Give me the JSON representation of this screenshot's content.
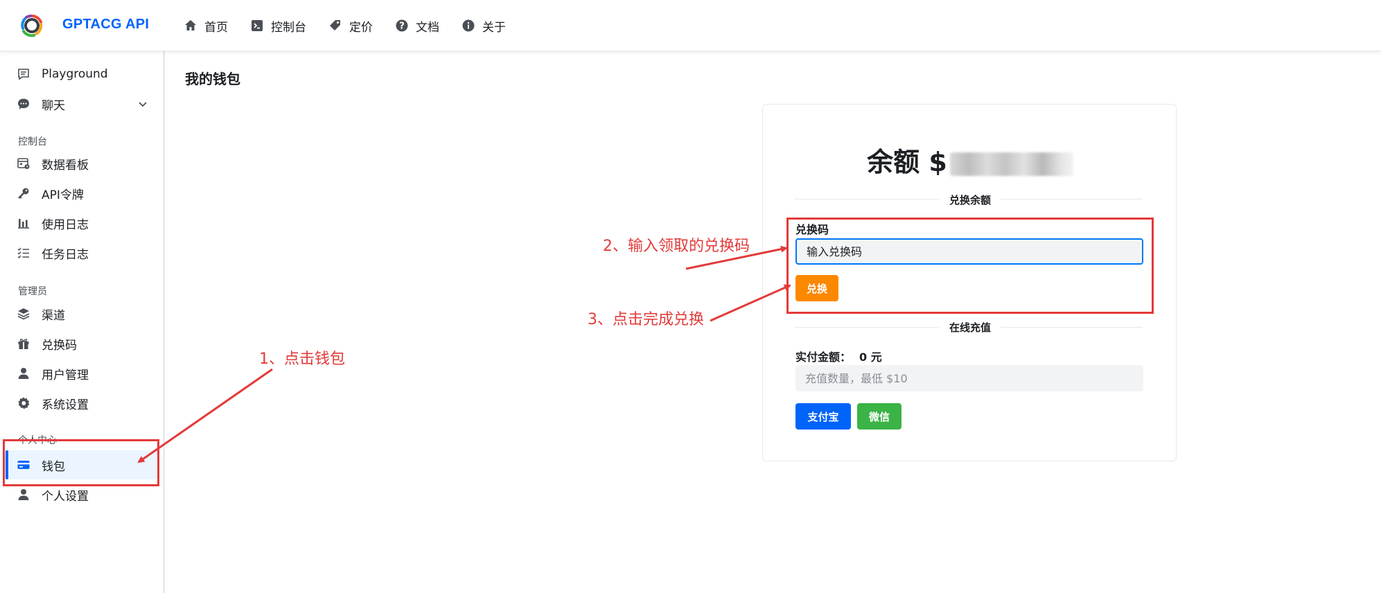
{
  "header": {
    "brand": "GPTACG API",
    "nav": [
      {
        "label": "首页",
        "icon": "home-icon"
      },
      {
        "label": "控制台",
        "icon": "terminal-icon"
      },
      {
        "label": "定价",
        "icon": "tag-icon"
      },
      {
        "label": "文档",
        "icon": "question-circle-icon"
      },
      {
        "label": "关于",
        "icon": "info-circle-icon"
      }
    ]
  },
  "sidebar": {
    "items_top": [
      {
        "label": "Playground",
        "icon": "comment-box-icon"
      },
      {
        "label": "聊天",
        "icon": "chat-bubble-icon"
      }
    ],
    "group_console": "控制台",
    "items_console": [
      {
        "label": "数据看板",
        "icon": "dashboard-calendar-icon"
      },
      {
        "label": "API令牌",
        "icon": "key-icon"
      },
      {
        "label": "使用日志",
        "icon": "bar-chart-icon"
      },
      {
        "label": "任务日志",
        "icon": "checklist-icon"
      }
    ],
    "group_admin": "管理员",
    "items_admin": [
      {
        "label": "渠道",
        "icon": "layers-icon"
      },
      {
        "label": "兑换码",
        "icon": "gift-icon"
      },
      {
        "label": "用户管理",
        "icon": "user-icon"
      },
      {
        "label": "系统设置",
        "icon": "gear-icon"
      }
    ],
    "group_personal": "个人中心",
    "items_personal": [
      {
        "label": "钱包",
        "icon": "credit-card-icon",
        "active": true
      },
      {
        "label": "个人设置",
        "icon": "user-icon"
      }
    ]
  },
  "main": {
    "page_title": "我的钱包",
    "balance_label": "余额 $",
    "redeem_section": "兑换余额",
    "code_label": "兑换码",
    "code_placeholder": "输入兑换码",
    "redeem_button": "兑换",
    "online_section": "在线充值",
    "pay_amount_label": "实付金额：",
    "pay_amount_value": "0 元",
    "amount_placeholder": "充值数量，最低 $10",
    "alipay_button": "支付宝",
    "wechat_button": "微信"
  },
  "annotations": {
    "step1": "1、点击钱包",
    "step2": "2、输入领取的兑换码",
    "step3": "3、点击完成兑换",
    "color": "#e33a3a"
  },
  "colors": {
    "brand": "#0064fa",
    "redeem_button": "#fc8800",
    "alipay_button": "#0064fa",
    "wechat_button": "#3bb346"
  }
}
